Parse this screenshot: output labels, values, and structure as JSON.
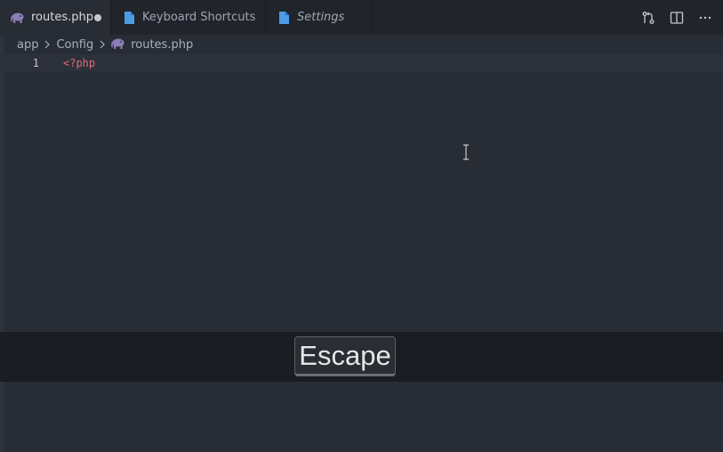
{
  "tabs": [
    {
      "label": "routes.php",
      "icon": "php-elephant-icon",
      "active": true,
      "dirty": true
    },
    {
      "label": "Keyboard Shortcuts",
      "icon": "file-icon",
      "active": false
    },
    {
      "label": "Settings",
      "icon": "file-icon",
      "active": false
    }
  ],
  "breadcrumb": {
    "items": [
      "app",
      "Config"
    ],
    "file": "routes.php"
  },
  "editor": {
    "lines": [
      {
        "number": "1",
        "text": "<?php"
      }
    ]
  },
  "keypress": {
    "label": "Escape"
  },
  "colors": {
    "php_icon": "#8c7fb8",
    "file_icon": "#4d9be6",
    "php_tag": "#e06c75"
  }
}
